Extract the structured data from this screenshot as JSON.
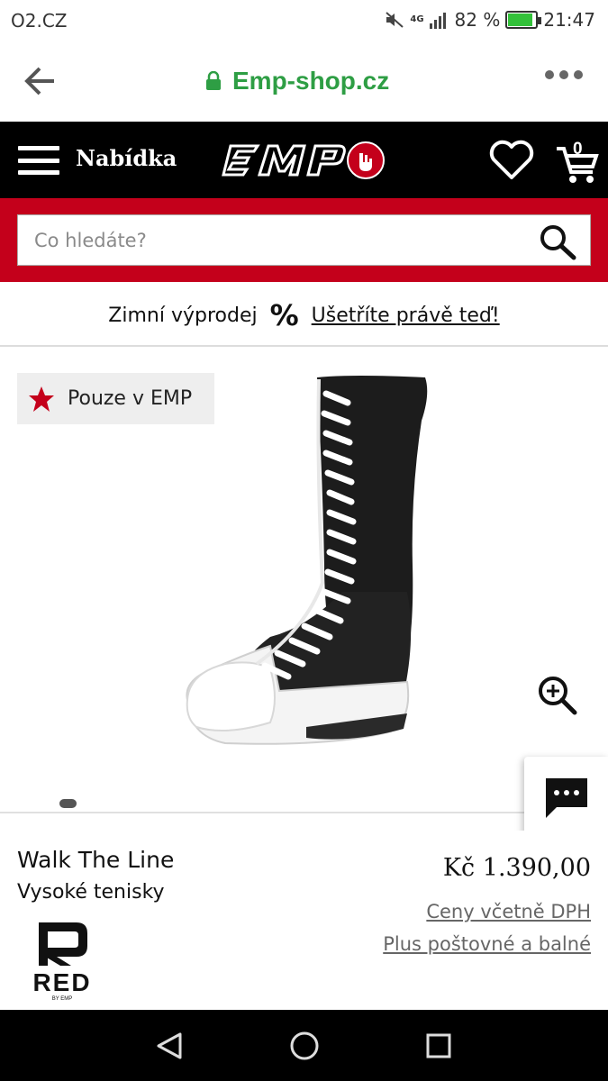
{
  "status_bar": {
    "carrier": "O2.CZ",
    "network": "4G",
    "battery_percent": "82 %",
    "battery_level": 0.82,
    "time": "21:47"
  },
  "browser": {
    "url": "Emp-shop.cz"
  },
  "header": {
    "menu_label": "Nabídka",
    "cart_count": "0"
  },
  "search": {
    "placeholder": "Co hledáte?"
  },
  "promo": {
    "text": "Zimní výprodej",
    "symbol": "%",
    "link": "Ušetříte právě teď!"
  },
  "gallery": {
    "badge": "Pouze v EMP"
  },
  "product": {
    "name": "Walk The Line",
    "type": "Vysoké tenisky",
    "price": "Kč 1.390,00",
    "vat_note": "Ceny včetně DPH",
    "shipping_note": "Plus poštovné a balné",
    "brand_logo_text": "RED BY EMP"
  },
  "colors": {
    "brand_red": "#c4001b",
    "url_green": "#2e9e44",
    "header_black": "#000000"
  }
}
